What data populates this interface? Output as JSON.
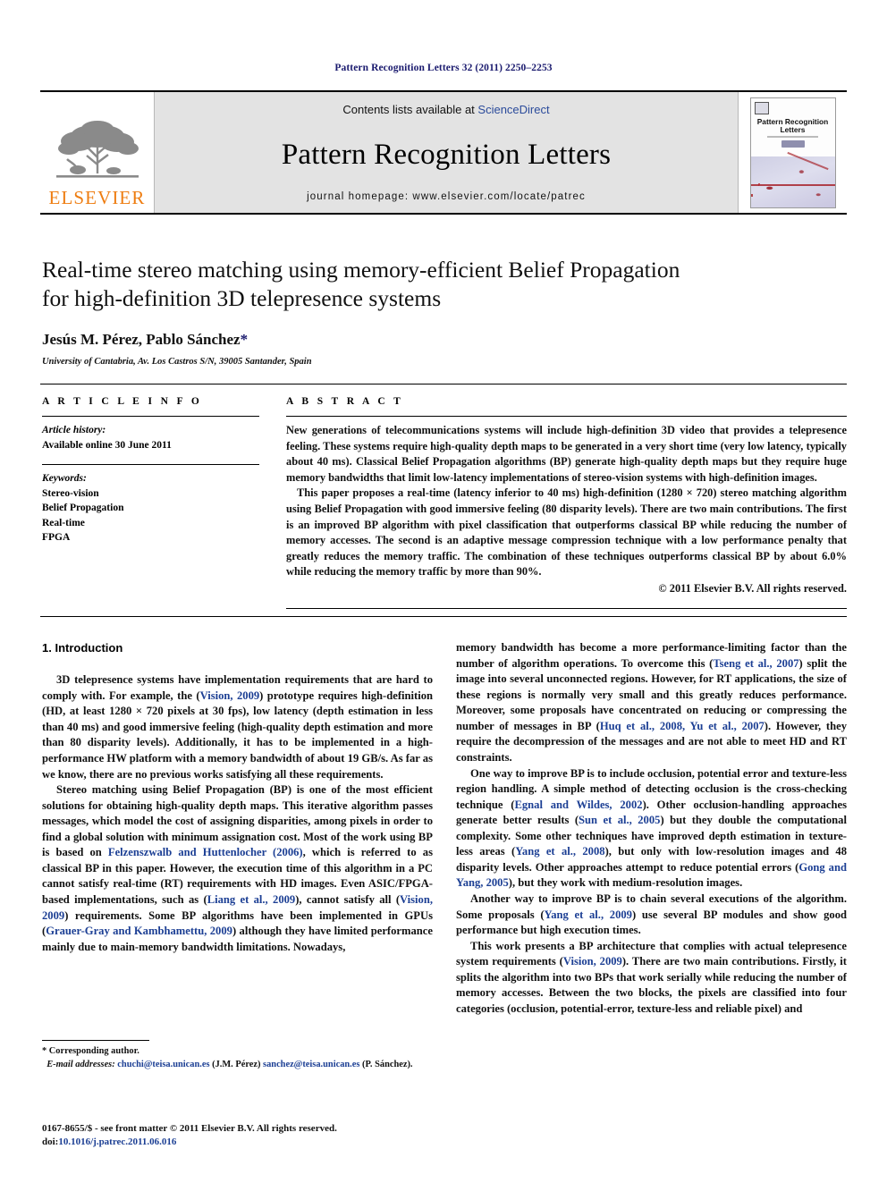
{
  "running_head": "Pattern Recognition Letters 32 (2011) 2250–2253",
  "masthead": {
    "publisher_wordmark": "ELSEVIER",
    "contents_prefix": "Contents lists available at ",
    "contents_link": "ScienceDirect",
    "journal_title": "Pattern Recognition Letters",
    "homepage": "journal homepage: www.elsevier.com/locate/patrec",
    "cover": {
      "title_line1": "Pattern Recognition",
      "title_line2": "Letters"
    }
  },
  "article": {
    "title_line1": "Real-time stereo matching using memory-efficient Belief Propagation",
    "title_line2": "for high-definition 3D telepresence systems",
    "authors": "Jesús M. Pérez, Pablo Sánchez",
    "corresponding_marker": "*",
    "affiliation": "University of Cantabria, Av. Los Castros S/N, 39005 Santander, Spain"
  },
  "article_info": {
    "heading": "A R T I C L E   I N F O",
    "history_label": "Article history:",
    "history_value": "Available online 30 June 2011",
    "keywords_label": "Keywords:",
    "keywords": [
      "Stereo-vision",
      "Belief Propagation",
      "Real-time",
      "FPGA"
    ]
  },
  "abstract": {
    "heading": "A B S T R A C T",
    "paragraph1": "New generations of telecommunications systems will include high-definition 3D video that provides a telepresence feeling. These systems require high-quality depth maps to be generated in a very short time (very low latency, typically about 40 ms). Classical Belief Propagation algorithms (BP) generate high-quality depth maps but they require huge memory bandwidths that limit low-latency implementations of stereo-vision systems with high-definition images.",
    "paragraph2": "This paper proposes a real-time (latency inferior to 40 ms) high-definition (1280 × 720) stereo matching algorithm using Belief Propagation with good immersive feeling (80 disparity levels). There are two main contributions. The first is an improved BP algorithm with pixel classification that outperforms classical BP while reducing the number of memory accesses. The second is an adaptive message compression technique with a low performance penalty that greatly reduces the memory traffic. The combination of these techniques outperforms classical BP by about 6.0% while reducing the memory traffic by more than 90%.",
    "copyright": "© 2011 Elsevier B.V. All rights reserved."
  },
  "body": {
    "section_heading": "1. Introduction",
    "left_column": {
      "p1_a": "3D telepresence systems have implementation requirements that are hard to comply with. For example, the (",
      "p1_cite1": "Vision, 2009",
      "p1_b": ") prototype requires high-definition (HD, at least 1280 × 720 pixels at 30 fps), low latency (depth estimation in less than 40 ms) and good immersive feeling (high-quality depth estimation and more than 80 disparity levels). Additionally, it has to be implemented in a high-performance HW platform with a memory bandwidth of about 19 GB/s. As far as we know, there are no previous works satisfying all these requirements.",
      "p2_a": "Stereo matching using Belief Propagation (BP) is one of the most efficient solutions for obtaining high-quality depth maps. This iterative algorithm passes messages, which model the cost of assigning disparities, among pixels in order to find a global solution with minimum assignation cost. Most of the work using BP is based on ",
      "p2_cite1": "Felzenszwalb and Huttenlocher (2006)",
      "p2_b": ", which is referred to as classical BP in this paper. However, the execution time of this algorithm in a PC cannot satisfy real-time (RT) requirements with HD images. Even ASIC/FPGA-based implementations, such as (",
      "p2_cite2": "Liang et al., 2009",
      "p2_c": "), cannot satisfy all (",
      "p2_cite3": "Vision, 2009",
      "p2_d": ") requirements. Some BP algorithms have been implemented in GPUs (",
      "p2_cite4": "Grauer-Gray and Kambhamettu, 2009",
      "p2_e": ") although they have limited performance mainly due to main-memory bandwidth limitations. Nowadays,"
    },
    "right_column": {
      "p1_a": "memory bandwidth has become a more performance-limiting factor than the number of algorithm operations. To overcome this (",
      "p1_cite1": "Tseng et al., 2007",
      "p1_b": ") split the image into several unconnected regions. However, for RT applications, the size of these regions is normally very small and this greatly reduces performance. Moreover, some proposals have concentrated on reducing or compressing the number of messages in BP (",
      "p1_cite2": "Huq et al., 2008, Yu et al., 2007",
      "p1_c": "). However, they require the decompression of the messages and are not able to meet HD and RT constraints.",
      "p2_a": "One way to improve BP is to include occlusion, potential error and texture-less region handling. A simple method of detecting occlusion is the cross-checking technique (",
      "p2_cite1": "Egnal and Wildes, 2002",
      "p2_b": "). Other occlusion-handling approaches generate better results (",
      "p2_cite2": "Sun et al., 2005",
      "p2_c": ") but they double the computational complexity. Some other techniques have improved depth estimation in texture-less areas (",
      "p2_cite3": "Yang et al., 2008",
      "p2_d": "), but only with low-resolution images and 48 disparity levels. Other approaches attempt to reduce potential errors (",
      "p2_cite4": "Gong and Yang, 2005",
      "p2_e": "), but they work with medium-resolution images.",
      "p3_a": "Another way to improve BP is to chain several executions of the algorithm. Some proposals (",
      "p3_cite1": "Yang et al., 2009",
      "p3_b": ") use several BP modules and show good performance but high execution times.",
      "p4_a": "This work presents a BP architecture that complies with actual telepresence system requirements (",
      "p4_cite1": "Vision, 2009",
      "p4_b": "). There are two main contributions. Firstly, it splits the algorithm into two BPs that work serially while reducing the number of memory accesses. Between the two blocks, the pixels are classified into four categories (occlusion, potential-error, texture-less and reliable pixel) and"
    }
  },
  "footnotes": {
    "corresponding": "* Corresponding author.",
    "email_label": "E-mail addresses:",
    "email1": "chuchi@teisa.unican.es",
    "email1_owner": "(J.M. Pérez)",
    "email2": "sanchez@teisa.unican.es",
    "email2_owner": "(P. Sánchez).",
    "issn_line": "0167-8655/$ - see front matter © 2011 Elsevier B.V. All rights reserved.",
    "doi_label": "doi:",
    "doi_value": "10.1016/j.patrec.2011.06.016"
  },
  "colors": {
    "link": "#1c3f94",
    "running_head": "#1a1a6e",
    "elsevier_orange": "#ee7d11",
    "masthead_bg": "#e3e3e3"
  }
}
